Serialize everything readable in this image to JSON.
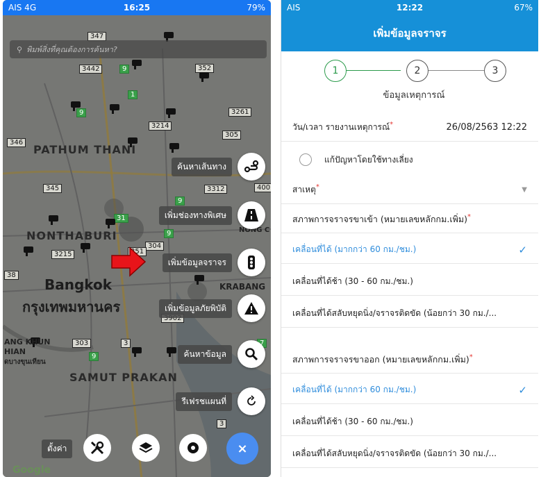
{
  "left": {
    "status_bar": {
      "carrier": "AIS 4G",
      "time": "16:25",
      "battery": "79%"
    },
    "search": {
      "placeholder": "พิมพ์สิ่งที่คุณต้องการค้นหา?"
    },
    "map_labels": {
      "pathum_thani": "PATHUM THANI",
      "nonthaburi": "NONTHABURI",
      "bangkok_en": "Bangkok",
      "bangkok_th": "กรุงเทพมหานคร",
      "samut_prakan": "SAMUT PRAKAN",
      "bang_khun": "ANG KHUN",
      "thian": "HIAN",
      "bang_khun_th": "ดบางขุนเทียน",
      "krabang": "KRABANG",
      "nong_c": "NONG C",
      "google": "Google"
    },
    "road_numbers": [
      "347",
      "3442",
      "9",
      "352",
      "1",
      "9",
      "3261",
      "3214",
      "305",
      "346",
      "345",
      "3312",
      "400",
      "9",
      "31",
      "9",
      "304",
      "351",
      "3215",
      "38",
      "3902",
      "303",
      "3",
      "9",
      "7",
      "3"
    ],
    "menu": [
      {
        "label": "ค้นหาเส้นทาง",
        "icon": "route-icon"
      },
      {
        "label": "เพิ่มช่องทางพิเศษ",
        "icon": "road-icon"
      },
      {
        "label": "เพิ่มข้อมูลจราจร",
        "icon": "traffic-light-icon"
      },
      {
        "label": "เพิ่มข้อมูลภัยพิบัติ",
        "icon": "warning-icon"
      },
      {
        "label": "ค้นหาข้อมูล",
        "icon": "search-icon"
      },
      {
        "label": "รีเฟรชแผนที่",
        "icon": "refresh-icon"
      }
    ],
    "bottom": {
      "settings_label": "ตั้งค่า",
      "close_symbol": "×"
    }
  },
  "right": {
    "status_bar": {
      "carrier": "AIS",
      "time": "12:22",
      "battery": "67%"
    },
    "title": "เพิ่มข้อมูลจราจร",
    "steps": [
      "1",
      "2",
      "3"
    ],
    "step_caption": "ข้อมูลเหตุการณ์",
    "datetime_label": "วัน/เวลา รายงานเหตุการณ์",
    "datetime_value": "26/08/2563 12:22",
    "detour_label": "แก้ปัญหาโดยใช้ทางเลี่ยง",
    "cause_label": "สาเหตุ",
    "inbound_label": "สภาพการจราจรขาเข้า (หมายเลขหลักกม.เพิ่ม)",
    "inbound_options": [
      {
        "label": "เคลื่อนที่ได้ (มากกว่า 60 กม./ชม.)",
        "selected": true
      },
      {
        "label": "เคลื่อนที่ได้ช้า (30 - 60 กม./ชม.)",
        "selected": false
      },
      {
        "label": "เคลื่อนที่ได้สลับหยุดนิ่ง/จราจรติดขัด (น้อยกว่า 30 กม./...",
        "selected": false
      }
    ],
    "outbound_label": "สภาพการจราจรขาออก (หมายเลขหลักกม.เพิ่ม)",
    "outbound_options": [
      {
        "label": "เคลื่อนที่ได้ (มากกว่า 60 กม./ชม.)",
        "selected": true
      },
      {
        "label": "เคลื่อนที่ได้ช้า (30 - 60 กม./ชม.)",
        "selected": false
      },
      {
        "label": "เคลื่อนที่ได้สลับหยุดนิ่ง/จราจรติดขัด (น้อยกว่า 30 กม./...",
        "selected": false
      }
    ],
    "required_mark": "*",
    "check_mark": "✓",
    "caret": "▼"
  },
  "colors": {
    "left_header": "#1877f2",
    "right_header": "#1690d8",
    "accent_green": "#2a9a4a",
    "selected_blue": "#2f8ddc",
    "required_red": "#e53935",
    "arrow_red": "#e8141a"
  }
}
